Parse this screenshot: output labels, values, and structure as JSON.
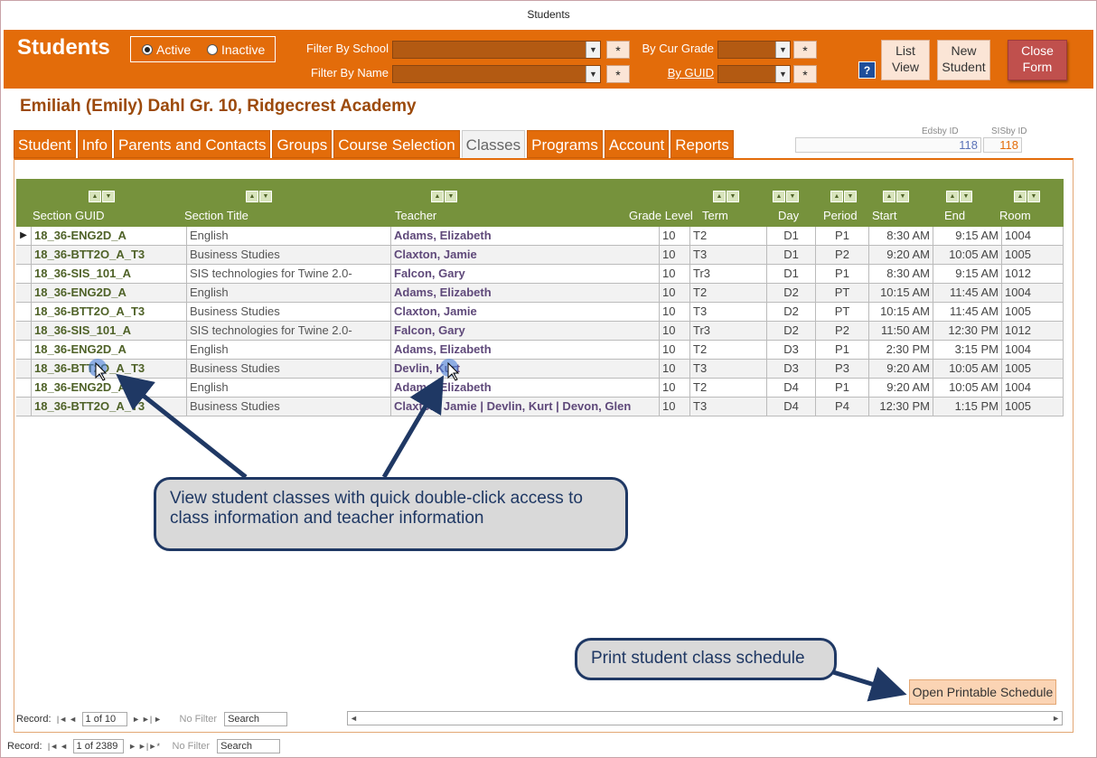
{
  "window": {
    "title": "Students"
  },
  "header": {
    "app_title": "Students",
    "status_active": "Active",
    "status_inactive": "Inactive",
    "filter_school_label": "Filter By School",
    "filter_name_label": "Filter By Name",
    "cur_grade_label": "By Cur Grade",
    "guid_label": "By GUID",
    "star": "*",
    "help": "?",
    "list_view": "List View",
    "new_student": "New Student",
    "close_form": "Close Form"
  },
  "student": {
    "name_line": "Emiliah (Emily)  Dahl  Gr. 10, Ridgecrest Academy",
    "edsby_id_label": "Edsby ID",
    "edsby_id": "118",
    "sisby_id_label": "SISby ID",
    "sisby_id": "118"
  },
  "tabs": [
    "Student",
    "Info",
    "Parents and Contacts",
    "Groups",
    "Course Selection",
    "Classes",
    "Programs",
    "Account",
    "Reports"
  ],
  "grid": {
    "headers": {
      "guid": "Section GUID",
      "title": "Section Title",
      "teacher": "Teacher",
      "grade": "Grade Level",
      "term": "Term",
      "day": "Day",
      "period": "Period",
      "start": "Start",
      "end": "End",
      "room": "Room"
    },
    "rows": [
      {
        "guid": "18_36-ENG2D_A",
        "title": "English",
        "teacher": "Adams, Elizabeth",
        "grade": "10",
        "term": "T2",
        "day": "D1",
        "period": "P1",
        "start": "8:30 AM",
        "end": "9:15 AM",
        "room": "1004"
      },
      {
        "guid": "18_36-BTT2O_A_T3",
        "title": "Business Studies",
        "teacher": "Claxton, Jamie",
        "grade": "10",
        "term": "T3",
        "day": "D1",
        "period": "P2",
        "start": "9:20 AM",
        "end": "10:05 AM",
        "room": "1005"
      },
      {
        "guid": "18_36-SIS_101_A",
        "title": "SIS technologies for Twine 2.0-",
        "teacher": "Falcon, Gary",
        "grade": "10",
        "term": "Tr3",
        "day": "D1",
        "period": "P1",
        "start": "8:30 AM",
        "end": "9:15 AM",
        "room": "1012"
      },
      {
        "guid": "18_36-ENG2D_A",
        "title": "English",
        "teacher": "Adams, Elizabeth",
        "grade": "10",
        "term": "T2",
        "day": "D2",
        "period": "PT",
        "start": "10:15 AM",
        "end": "11:45 AM",
        "room": "1004"
      },
      {
        "guid": "18_36-BTT2O_A_T3",
        "title": "Business Studies",
        "teacher": "Claxton, Jamie",
        "grade": "10",
        "term": "T3",
        "day": "D2",
        "period": "PT",
        "start": "10:15 AM",
        "end": "11:45 AM",
        "room": "1005"
      },
      {
        "guid": "18_36-SIS_101_A",
        "title": "SIS technologies for Twine 2.0-",
        "teacher": "Falcon, Gary",
        "grade": "10",
        "term": "Tr3",
        "day": "D2",
        "period": "P2",
        "start": "11:50 AM",
        "end": "12:30 PM",
        "room": "1012"
      },
      {
        "guid": "18_36-ENG2D_A",
        "title": "English",
        "teacher": "Adams, Elizabeth",
        "grade": "10",
        "term": "T2",
        "day": "D3",
        "period": "P1",
        "start": "2:30 PM",
        "end": "3:15 PM",
        "room": "1004"
      },
      {
        "guid": "18_36-BTT2O_A_T3",
        "title": "Business Studies",
        "teacher": "Devlin, Kurt",
        "grade": "10",
        "term": "T3",
        "day": "D3",
        "period": "P3",
        "start": "9:20 AM",
        "end": "10:05 AM",
        "room": "1005"
      },
      {
        "guid": "18_36-ENG2D_A",
        "title": "English",
        "teacher": "Adams, Elizabeth",
        "grade": "10",
        "term": "T2",
        "day": "D4",
        "period": "P1",
        "start": "9:20 AM",
        "end": "10:05 AM",
        "room": "1004"
      },
      {
        "guid": "18_36-BTT2O_A_T3",
        "title": "Business Studies",
        "teacher": "Claxton, Jamie | Devlin, Kurt | Devon, Glen",
        "grade": "10",
        "term": "T3",
        "day": "D4",
        "period": "P4",
        "start": "12:30 PM",
        "end": "1:15 PM",
        "room": "1005"
      }
    ]
  },
  "callouts": {
    "classes": "View student classes with quick double-click access to class information and teacher information",
    "print": "Print student class schedule"
  },
  "print_button": "Open Printable Schedule",
  "subform_nav": {
    "record_label": "Record:",
    "record_value": "1 of 10",
    "no_filter": "No Filter",
    "search": "Search"
  },
  "form_nav": {
    "record_label": "Record:",
    "record_value": "1 of 2389",
    "no_filter": "No Filter",
    "search": "Search"
  }
}
